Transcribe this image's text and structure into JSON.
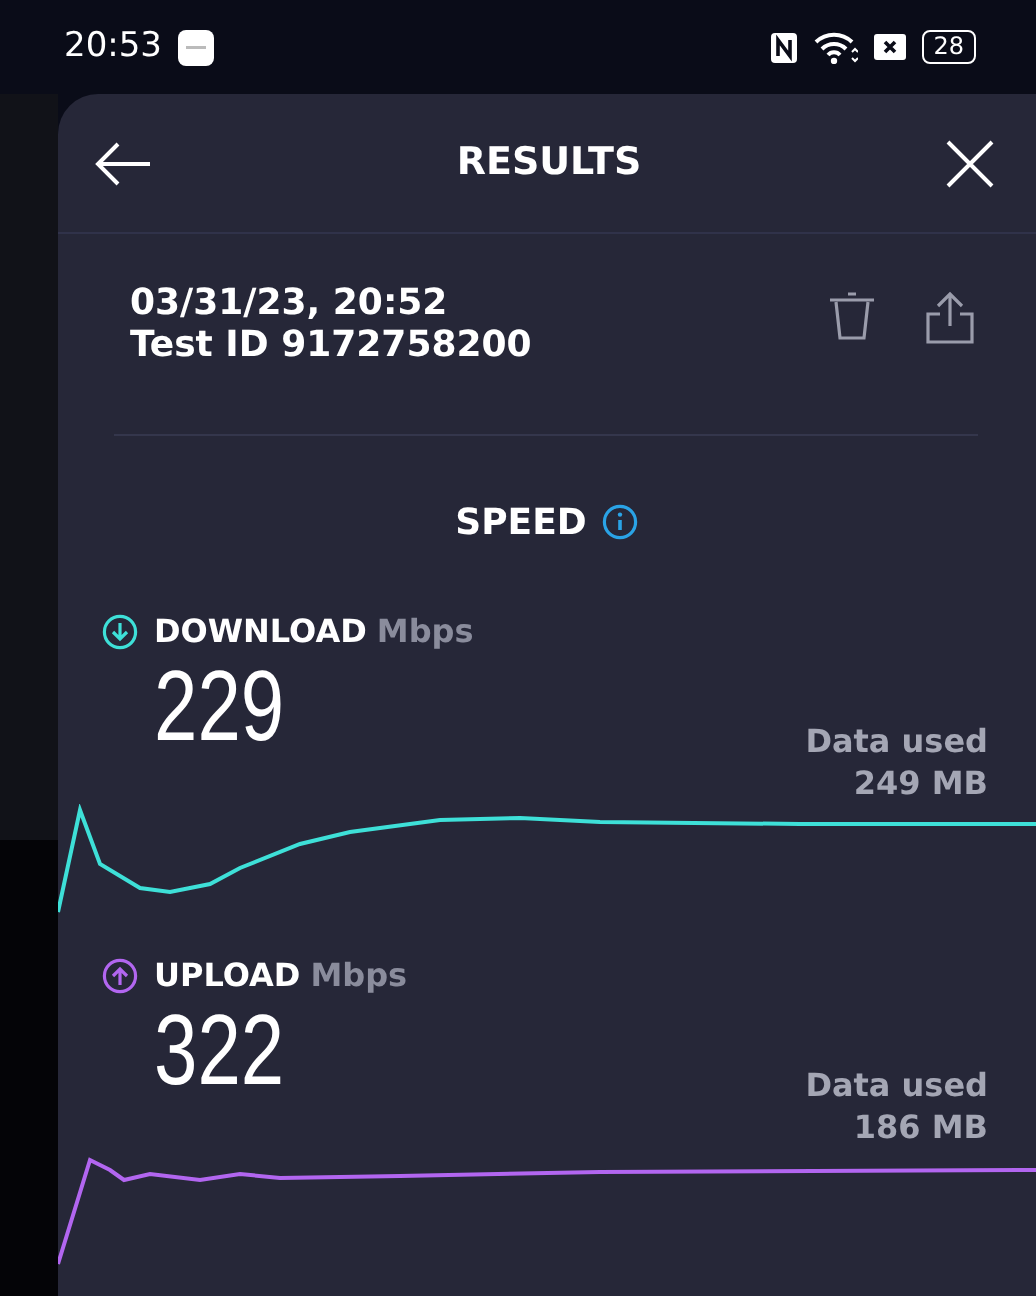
{
  "status_bar": {
    "time": "20:53",
    "battery": "28"
  },
  "header": {
    "title": "RESULTS"
  },
  "result": {
    "date": "03/31/23, 20:52",
    "test_id": "Test ID 9172758200"
  },
  "section": {
    "title": "SPEED"
  },
  "tests": [
    {
      "kind": "download",
      "label": "DOWNLOAD",
      "unit": "Mbps",
      "value": "229",
      "data_label": "Data used",
      "data_value": "249 MB",
      "color": "#3ee0d8"
    },
    {
      "kind": "upload",
      "label": "UPLOAD",
      "unit": "Mbps",
      "value": "322",
      "data_label": "Data used",
      "data_value": "186 MB",
      "color": "#b266f0"
    }
  ]
}
